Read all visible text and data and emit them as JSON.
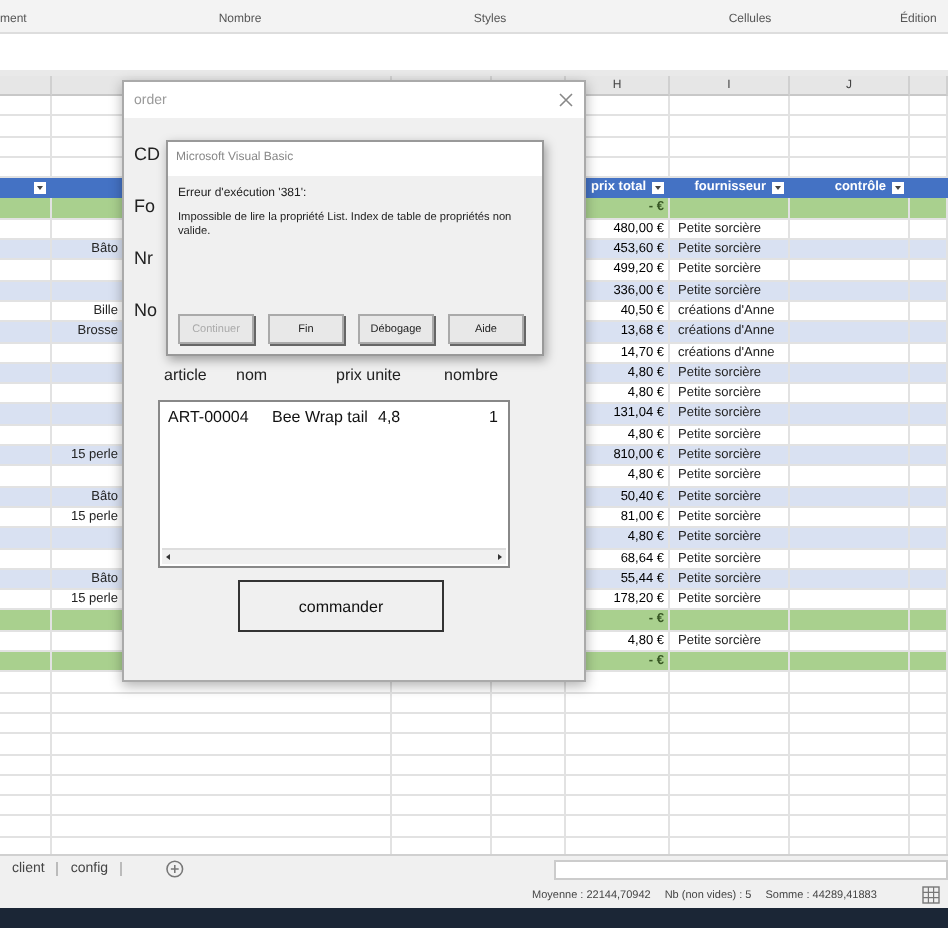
{
  "ribbon": {
    "groups": [
      "ment",
      "Nombre",
      "Styles",
      "Cellules",
      "Édition"
    ]
  },
  "sheet": {
    "column_headers": [
      "H",
      "I",
      "J"
    ],
    "filter_columns": [
      "prix total",
      "fournisseur",
      "contrôle"
    ],
    "rows": [
      {
        "kind": "total",
        "prix_total": "-   €"
      },
      {
        "kind": "data",
        "prix_total": "480,00 €",
        "fournisseur": "Petite sorcière"
      },
      {
        "kind": "data",
        "item": "Bâto",
        "prix_total": "453,60 €",
        "fournisseur": "Petite sorcière"
      },
      {
        "kind": "data",
        "prix_total": "499,20 €",
        "fournisseur": "Petite sorcière"
      },
      {
        "kind": "data",
        "prix_total": "336,00 €",
        "fournisseur": "Petite sorcière"
      },
      {
        "kind": "data",
        "item": "Bille",
        "prix_total": "40,50 €",
        "fournisseur": "créations d'Anne"
      },
      {
        "kind": "data",
        "item": "Brosse",
        "prix_total": "13,68 €",
        "fournisseur": "créations d'Anne"
      },
      {
        "kind": "data",
        "prix_total": "14,70 €",
        "fournisseur": "créations d'Anne"
      },
      {
        "kind": "data",
        "prix_total": "4,80 €",
        "fournisseur": "Petite sorcière"
      },
      {
        "kind": "data",
        "prix_total": "4,80 €",
        "fournisseur": "Petite sorcière"
      },
      {
        "kind": "data",
        "prix_total": "131,04 €",
        "fournisseur": "Petite sorcière"
      },
      {
        "kind": "data",
        "prix_total": "4,80 €",
        "fournisseur": "Petite sorcière"
      },
      {
        "kind": "data",
        "item": "15 perle",
        "prix_total": "810,00 €",
        "fournisseur": "Petite sorcière"
      },
      {
        "kind": "data",
        "prix_total": "4,80 €",
        "fournisseur": "Petite sorcière"
      },
      {
        "kind": "data",
        "item": "Bâto",
        "prix_total": "50,40 €",
        "fournisseur": "Petite sorcière"
      },
      {
        "kind": "data",
        "item": "15 perle",
        "prix_total": "81,00 €",
        "fournisseur": "Petite sorcière"
      },
      {
        "kind": "data",
        "prix_total": "4,80 €",
        "fournisseur": "Petite sorcière"
      },
      {
        "kind": "data",
        "prix_total": "68,64 €",
        "fournisseur": "Petite sorcière"
      },
      {
        "kind": "data",
        "item": "Bâto",
        "prix_total": "55,44 €",
        "fournisseur": "Petite sorcière"
      },
      {
        "kind": "data",
        "item": "15 perle",
        "prix_total": "178,20 €",
        "fournisseur": "Petite sorcière"
      },
      {
        "kind": "total",
        "prix_total": "-   €"
      },
      {
        "kind": "data",
        "prix_total": "4,80 €",
        "fournisseur": "Petite sorcière"
      },
      {
        "kind": "total",
        "prix_total": "-   €"
      }
    ]
  },
  "sheet_tabs": [
    {
      "label": "client",
      "selected": false
    },
    {
      "label": "config",
      "selected": false
    }
  ],
  "status_bar": [
    "Moyenne : 22144,70942",
    "Nb (non vides) : 5",
    "Somme : 44289,41883"
  ],
  "order_dialog": {
    "title": "order",
    "labels": [
      "CD",
      "Fo",
      "Nr",
      "No"
    ],
    "list_columns": [
      "article",
      "nom",
      "prix unite",
      "nombre"
    ],
    "list_rows": [
      [
        "ART-00004",
        "Bee Wrap tail",
        "4,8",
        "1"
      ]
    ],
    "button": "commander"
  },
  "error_dialog": {
    "title": "Microsoft Visual Basic",
    "heading": "Erreur d'exécution '381':",
    "message": "Impossible de lire la propriété List. Index de table de propriétés non valide.",
    "buttons": [
      {
        "label": "Continuer",
        "disabled": true
      },
      {
        "label": "Fin",
        "disabled": false
      },
      {
        "label": "Débogage",
        "disabled": false
      },
      {
        "label": "Aide",
        "disabled": false
      }
    ]
  }
}
